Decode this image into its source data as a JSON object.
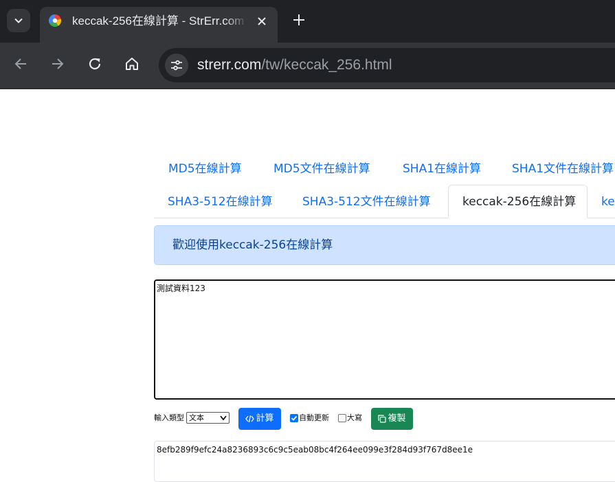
{
  "browser": {
    "tab": {
      "title": "keccak-256在線計算 - StrErr.com"
    },
    "address": {
      "host": "strerr.com",
      "path": "/tw/keccak_256.html"
    }
  },
  "nav": {
    "row1": [
      "MD5在線計算",
      "MD5文件在線計算",
      "SHA1在線計算",
      "SHA1文件在線計算"
    ],
    "row2": [
      "SHA3-512在線計算",
      "SHA3-512文件在線計算",
      "keccak-256在線計算",
      "ke"
    ]
  },
  "alert": {
    "text": "歡迎使用keccak-256在線計算"
  },
  "input": {
    "value": "測試資料123"
  },
  "controls": {
    "input_type_label": "輸入類型",
    "input_type_selected": "文本",
    "compute_label": "計算",
    "auto_update_label": "自動更新",
    "auto_update_checked": true,
    "uppercase_label": "大寫",
    "uppercase_checked": false,
    "copy_label": "複製"
  },
  "output": {
    "value": "8efb289f9efc24a8236893c6c9c5eab08bc4f264ee099e3f284d93f767d8ee1e"
  },
  "icons": {
    "tab_search": "chevron-down-icon",
    "favicon": "strerr-favicon-icon",
    "close": "close-icon",
    "new_tab": "plus-icon",
    "back": "arrow-left-icon",
    "forward": "arrow-right-icon",
    "reload": "reload-icon",
    "home": "home-icon",
    "site_info": "tune-icon",
    "compute": "code-icon",
    "copy": "copy-icon"
  },
  "colors": {
    "chrome_dark": "#202124",
    "chrome_toolbar": "#35363a",
    "link": "#0d6efd",
    "alert_bg": "#cfe2ff",
    "alert_text": "#084298",
    "primary": "#0d6efd",
    "success": "#198754"
  }
}
